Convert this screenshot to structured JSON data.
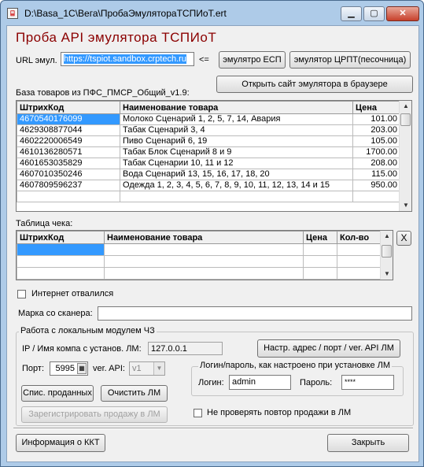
{
  "window": {
    "title": "D:\\Basa_1C\\Вега\\ПробаЭмулятораТСПИоТ.ert"
  },
  "form": {
    "heading": "Проба API эмулятора  ТСПИоТ",
    "url_label": "URL эмул.",
    "url_value": "https://tspiot.sandbox.crptech.ru",
    "arrow": "<=",
    "btn_emul_esp": "эмулятро ЕСП",
    "btn_emul_crpt": "эмулятор ЦРПТ(песочница)",
    "btn_open_site": "Открыть сайт эмулятора в браузере",
    "goods_label": "База товаров из ПФС_ПМСР_Общий_v1.9:",
    "goods_headers": [
      "ШтрихКод",
      "Наименование товара",
      "Цена"
    ],
    "goods_rows": [
      [
        "4670540176099",
        "Молоко Сценарий 1, 2, 5, 7, 14, Авария",
        "101.00"
      ],
      [
        "4629308877044",
        "Табак Сценарий 3, 4",
        "203.00"
      ],
      [
        "4602220006549",
        "Пиво Сценарий 6, 19",
        "105.00"
      ],
      [
        "4610136280571",
        "Табак Блок Сценарий 8 и 9",
        "1700.00"
      ],
      [
        "4601653035829",
        "Табак Сценарии 10, 11 и 12",
        "208.00"
      ],
      [
        "4607010350246",
        "Вода Сценарий 13, 15, 16, 17, 18, 20",
        "115.00"
      ],
      [
        "4607809596237",
        "Одежда 1, 2, 3, 4, 5, 6, 7, 8, 9, 10, 11, 12, 13, 14 и 15",
        "950.00"
      ]
    ],
    "check_label": "Таблица чека:",
    "check_headers": [
      "ШтрихКод",
      "Наименование товара",
      "Цена",
      "Кол-во"
    ],
    "clear_check": "X",
    "internet_label": "Интернет отвалился",
    "scanner_label": "Марка со сканера:",
    "scanner_value": "",
    "group_lm_title": "Работа с локальным модулем ЧЗ",
    "ip_label": "IP / Имя компа с установ. ЛМ:",
    "ip_value": "127.0.0.1",
    "btn_setup_lm": "Настр. адрес / порт / ver. API ЛМ",
    "port_label": "Порт:",
    "port_value": "5995",
    "api_label": "ver. API:",
    "api_value": "v1",
    "btn_sold_list": "Спис. проданных",
    "btn_clear_lm": "Очистить ЛМ",
    "btn_register_sale": "Зарегистрировать продажу в ЛМ",
    "login_group_title": "Логин/пароль, как настроено при установке ЛМ",
    "login_label": "Логин:",
    "login_value": "admin",
    "password_label": "Пароль:",
    "password_value": "****",
    "no_repeat_label": "Не проверять повтор продажи в ЛМ",
    "btn_info_kkt": "Информация о ККТ",
    "btn_close": "Закрыть"
  }
}
